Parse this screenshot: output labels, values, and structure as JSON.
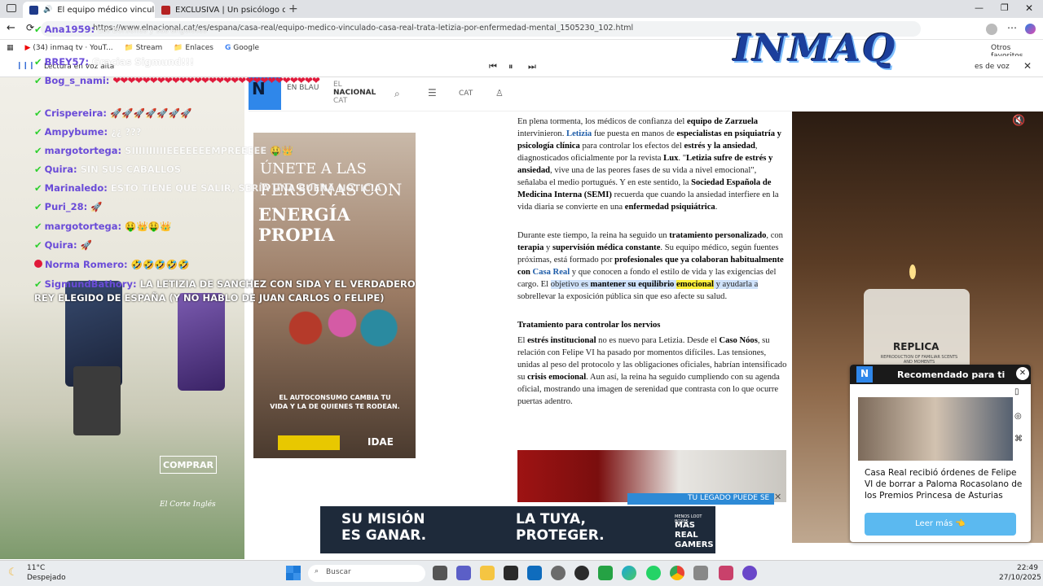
{
  "tabs": [
    {
      "title": "El equipo médico vinculado",
      "active": true
    },
    {
      "title": "EXCLUSIVA | Un psicólogo desvel",
      "active": false
    }
  ],
  "url": "https://www.elnacional.cat/es/espana/casa-real/equipo-medico-vinculado-casa-real-trata-letizia-por-enfermedad-mental_1505230_102.html",
  "bookmarks": [
    "(34) inmaq tv · YouT...",
    "Stream",
    "Enlaces",
    "Google",
    "Otros favoritos"
  ],
  "read_aloud": "Lectura en voz alta",
  "read_aloud_right": "es de voz",
  "site_nav": {
    "logo": "N",
    "enblau": "EN BLAU",
    "el": "EL",
    "nacional": "NACIONAL",
    "cat_small": "CAT",
    "cat": "CAT"
  },
  "article": {
    "p1_a": "En plena tormenta, los médicos de confianza del ",
    "p1_b": "equipo de Zarzuela",
    "p1_c": " intervinieron. ",
    "p1_d": "Letizia",
    "p1_e": " fue puesta en manos de ",
    "p1_f": "especialistas en psiquiatría y psicología clínica",
    "p1_g": " para controlar los efectos del ",
    "p1_h": "estrés y la ansiedad",
    "p1_i": ", diagnosticados oficialmente por la revista ",
    "p1_j": "Lux",
    "p1_k": ". \"",
    "p1_l": "Letizia sufre de estrés y ansiedad",
    "p1_m": ", vive una de las peores fases de su vida a nivel emocional\", señalaba el medio portugués. Y en este sentido, la ",
    "p1_n": "Sociedad Española de Medicina Interna (SEMI)",
    "p1_o": " recuerda que cuando la ansiedad interfiere en la vida diaria se convierte en una ",
    "p1_p": "enfermedad psiquiátrica",
    "p1_q": ".",
    "p2_a": "Durante este tiempo, la reina ha seguido un ",
    "p2_b": "tratamiento personalizado",
    "p2_c": ", con ",
    "p2_d": "terapia",
    "p2_e": " y ",
    "p2_f": "supervisión médica constante",
    "p2_g": ". Su equipo médico, según fuentes próximas, está formado por ",
    "p2_h": "profesionales que ya colaboran habitualmente con ",
    "p2_i": "Casa Real",
    "p2_j": " y que conocen a fondo el estilo de vida y las exigencias del cargo. El ",
    "p2_k": "objetivo es ",
    "p2_l": "mantener su equilibrio ",
    "p2_m": "emocional",
    "p2_n": " y ayudarla a",
    "p2_o": " sobrellevar la exposición pública sin que eso afecte su salud.",
    "h3": "Tratamiento para controlar los nervios",
    "p3_a": "El ",
    "p3_b": "estrés institucional",
    "p3_c": " no es nuevo para Letizia. Desde el ",
    "p3_d": "Caso Nóos",
    "p3_e": ", su relación con Felipe VI ha pasado por momentos difíciles. Las tensiones, unidas al peso del protocolo y las obligaciones oficiales, habrían intensificado su ",
    "p3_f": "crisis emocional",
    "p3_g": ". Aun así, la reina ha seguido cumpliendo con su agenda oficial, mostrando una imagen de serenidad que contrasta con lo que ocurre puertas adentro."
  },
  "vertical_ad": {
    "line1": "ÚNETE A LAS",
    "line2": "PERSONAS CON",
    "line3": "ENERGÍA PROPIA",
    "tagline": "EL AUTOCONSUMO CAMBIA TU VIDA Y LA DE QUIENES TE RODEAN.",
    "brand": "IDAE"
  },
  "left_ad": {
    "cta": "COMPRAR",
    "brand": "El Corte Inglés"
  },
  "right_ad": {
    "product": "REPLICA",
    "sub": "REPRODUCTION OF FAMILIAR SCENTS AND MOMENTS"
  },
  "recommend": {
    "header": "Recomendado para ti",
    "title": "Casa Real recibió órdenes de Felipe VI de borrar a Paloma Rocasolano de los Premios Princesa de Asturias",
    "button": "Leer más 👈"
  },
  "legado": "TU LEGADO PUEDE SE",
  "bottom_ad": {
    "left": "SU MISIÓN ES GANAR.",
    "mid": "LA TUYA, PROTEGER.",
    "right_small": "MENOS LOOT BOXES",
    "right": "MÁS REAL GAMERS"
  },
  "stream_logo": "INMAQ",
  "chat": [
    {
      "user": "Ana1959:",
      "msg": "Los Borbones y sus angelotes",
      "badge": "check"
    },
    {
      "user": "BREY57:",
      "msg": "Gracias Sigmund!!!",
      "badge": "check"
    },
    {
      "user": "Bog_s_nami:",
      "msg": "❤❤❤❤❤❤❤❤❤❤❤❤❤❤❤❤❤❤❤❤❤❤❤❤❤❤❤❤",
      "badge": "check"
    },
    {
      "user": "Crispereira:",
      "msg": "🚀🚀🚀🚀🚀🚀🚀",
      "badge": "check"
    },
    {
      "user": "Ampybume:",
      "msg": "¿¿ ???",
      "badge": "check"
    },
    {
      "user": "margotortega:",
      "msg": "SIIIIIIIIIIEEEEEEEMPREEEEE 🤑👑",
      "badge": "check"
    },
    {
      "user": "Quira:",
      "msg": "SIN SUS CABALLOS",
      "badge": "check"
    },
    {
      "user": "Marinaledo:",
      "msg": "ESTO TIENE QUE SALIR, SERÍA UNA BUENA NOTICIA",
      "badge": "check"
    },
    {
      "user": "Puri_28:",
      "msg": "🚀",
      "badge": "check"
    },
    {
      "user": "margotortega:",
      "msg": "🤑👑🤑👑",
      "badge": "check"
    },
    {
      "user": "Quira:",
      "msg": "🚀",
      "badge": "check"
    },
    {
      "user": "Norma Romero:",
      "msg": "🤣🤣🤣🤣🤣",
      "badge": "youtube"
    },
    {
      "user": "SigmundBathory:",
      "msg": "LA LETIZIA DE SANCHEZ CON SIDA Y EL VERDADERO REY ELEGIDO DE ESPAÑA (Y NO HABLO DE JUAN CARLOS O FELIPE)",
      "badge": "check"
    }
  ],
  "taskbar": {
    "temp": "11°C",
    "weather": "Despejado",
    "search": "Buscar",
    "time": "22:49",
    "date": "27/10/2025"
  },
  "colors": {
    "accent_blue": "#1d5ca8",
    "chat_user": "#6a4bd8",
    "check_green": "#2fd02f",
    "recommend_button": "#5bb9f0"
  }
}
